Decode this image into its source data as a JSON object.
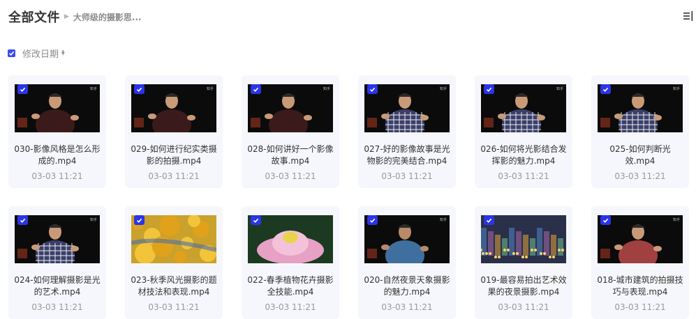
{
  "header": {
    "title": "全部文件",
    "breadcrumb": "大师级的摄影思..."
  },
  "toolbar": {
    "sort_label": "修改日期",
    "select_all_checked": true,
    "view_toggle_icon": "list-view-icon"
  },
  "colors": {
    "accent": "#2b34e8",
    "card_bg": "#f6f7fc",
    "date_text": "#999999"
  },
  "files": [
    {
      "name": "030-影像风格是怎么形成的.mp4",
      "date": "03-03 11:21",
      "selected": true,
      "thumb": "man-speaking-dark"
    },
    {
      "name": "029-如何进行纪实类摄影的拍摄.mp4",
      "date": "03-03 11:21",
      "selected": true,
      "thumb": "man-speaking-dark"
    },
    {
      "name": "028-如何讲好一个影像故事.mp4",
      "date": "03-03 11:21",
      "selected": true,
      "thumb": "man-speaking-dark"
    },
    {
      "name": "027-好的影像故事是光物影的完美结合.mp4",
      "date": "03-03 11:21",
      "selected": true,
      "thumb": "man-plaid-shirt"
    },
    {
      "name": "026-如何将光影结合发挥影的魅力.mp4",
      "date": "03-03 11:21",
      "selected": true,
      "thumb": "man-plaid-shirt"
    },
    {
      "name": "025-如何判断光效.mp4",
      "date": "03-03 11:21",
      "selected": true,
      "thumb": "man-plaid-shirt"
    },
    {
      "name": "024-如何理解摄影是光的艺术.mp4",
      "date": "03-03 11:21",
      "selected": true,
      "thumb": "man-plaid-shirt"
    },
    {
      "name": "023-秋季风光摄影的题材技法和表现.mp4",
      "date": "03-03 11:21",
      "selected": true,
      "thumb": "autumn-leaves"
    },
    {
      "name": "022-春季植物花卉摄影全技能.mp4",
      "date": "03-03 11:21",
      "selected": true,
      "thumb": "lotus-flower"
    },
    {
      "name": "020-自然夜景天象摄影的魅力.mp4",
      "date": "03-03 11:21",
      "selected": true,
      "thumb": "man-blue-shirt"
    },
    {
      "name": "019-最容易拍出艺术效果的夜景摄影.mp4",
      "date": "03-03 11:21",
      "selected": true,
      "thumb": "city-night"
    },
    {
      "name": "018-城市建筑的拍摄技巧与表现.mp4",
      "date": "03-03 11:21",
      "selected": true,
      "thumb": "man-red-sweater"
    }
  ]
}
